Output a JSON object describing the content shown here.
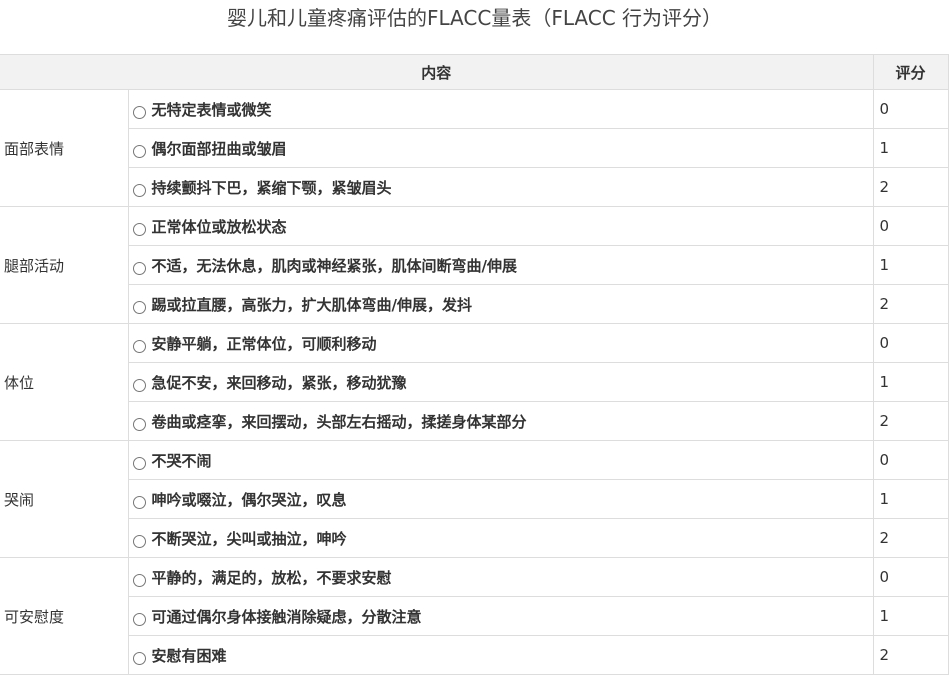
{
  "title": "婴儿和儿童疼痛评估的FLACC量表（FLACC 行为评分）",
  "headers": {
    "content": "内容",
    "score": "评分"
  },
  "categories": [
    {
      "label": "面部表情",
      "rows": [
        {
          "text": "无特定表情或微笑",
          "score": "0"
        },
        {
          "text": "偶尔面部扭曲或皱眉",
          "score": "1"
        },
        {
          "text": "持续颤抖下巴，紧缩下颚，紧皱眉头",
          "score": "2"
        }
      ]
    },
    {
      "label": "腿部活动",
      "rows": [
        {
          "text": "正常体位或放松状态",
          "score": "0"
        },
        {
          "text": "不适，无法休息，肌肉或神经紧张，肌体间断弯曲/伸展",
          "score": "1"
        },
        {
          "text": "踢或拉直腰，高张力，扩大肌体弯曲/伸展，发抖",
          "score": "2"
        }
      ]
    },
    {
      "label": "体位",
      "rows": [
        {
          "text": "安静平躺，正常体位，可顺利移动",
          "score": "0"
        },
        {
          "text": "急促不安，来回移动，紧张，移动犹豫",
          "score": "1"
        },
        {
          "text": "卷曲或痉挛，来回摆动，头部左右摇动，揉搓身体某部分",
          "score": "2"
        }
      ]
    },
    {
      "label": "哭闹",
      "rows": [
        {
          "text": "不哭不闹",
          "score": "0"
        },
        {
          "text": "呻吟或啜泣，偶尔哭泣，叹息",
          "score": "1"
        },
        {
          "text": "不断哭泣，尖叫或抽泣，呻吟",
          "score": "2"
        }
      ]
    },
    {
      "label": "可安慰度",
      "rows": [
        {
          "text": "平静的，满足的，放松，不要求安慰",
          "score": "0"
        },
        {
          "text": "可通过偶尔身体接触消除疑虑，分散注意",
          "score": "1"
        },
        {
          "text": "安慰有困难",
          "score": "2"
        }
      ]
    }
  ]
}
